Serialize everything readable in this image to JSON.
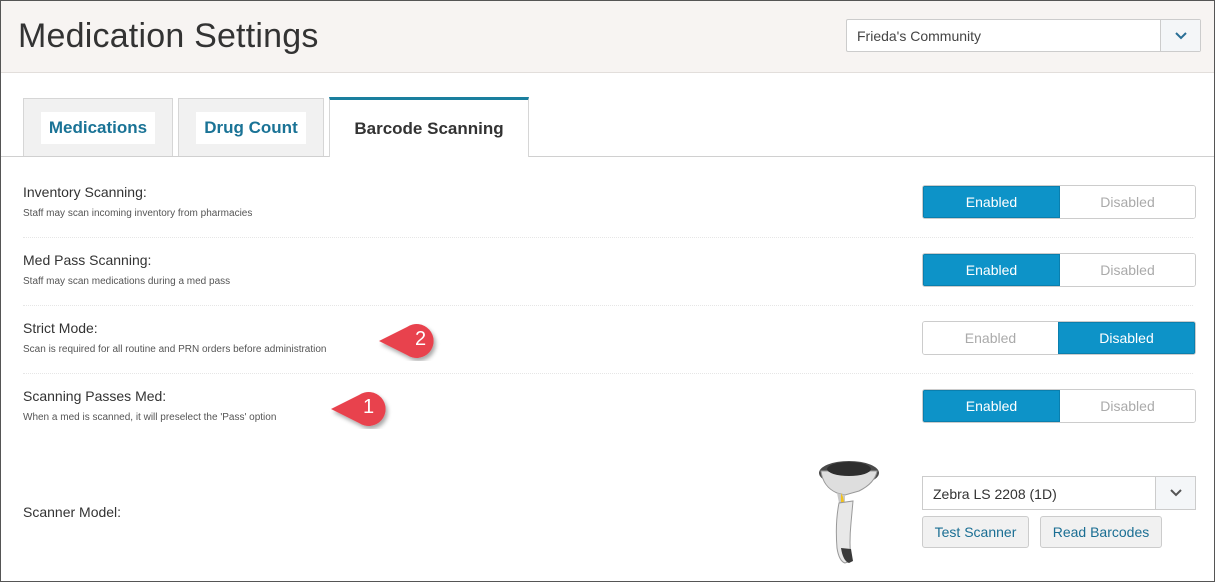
{
  "header": {
    "title": "Medication Settings",
    "community": "Frieda's Community"
  },
  "tabs": [
    {
      "label": "Medications"
    },
    {
      "label": "Drug Count"
    },
    {
      "label": "Barcode Scanning",
      "active": true
    }
  ],
  "settings": [
    {
      "label": "Inventory Scanning:",
      "description": "Staff may scan incoming inventory from pharmacies",
      "enabled_label": "Enabled",
      "disabled_label": "Disabled",
      "value": "Enabled"
    },
    {
      "label": "Med Pass Scanning:",
      "description": "Staff may scan medications during a med pass",
      "enabled_label": "Enabled",
      "disabled_label": "Disabled",
      "value": "Enabled"
    },
    {
      "label": "Strict Mode:",
      "description": "Scan is required for all routine and PRN orders before administration",
      "enabled_label": "Enabled",
      "disabled_label": "Disabled",
      "value": "Disabled"
    },
    {
      "label": "Scanning Passes Med:",
      "description": "When a med is scanned, it will preselect the 'Pass' option",
      "enabled_label": "Enabled",
      "disabled_label": "Disabled",
      "value": "Enabled"
    }
  ],
  "callouts": [
    "2",
    "1"
  ],
  "scanner": {
    "label": "Scanner Model:",
    "model": "Zebra LS 2208 (1D)",
    "test_button": "Test Scanner",
    "read_button": "Read Barcodes"
  },
  "colors": {
    "accent": "#0d93c8",
    "tab_text": "#1a7396",
    "callout": "#e8424d"
  }
}
